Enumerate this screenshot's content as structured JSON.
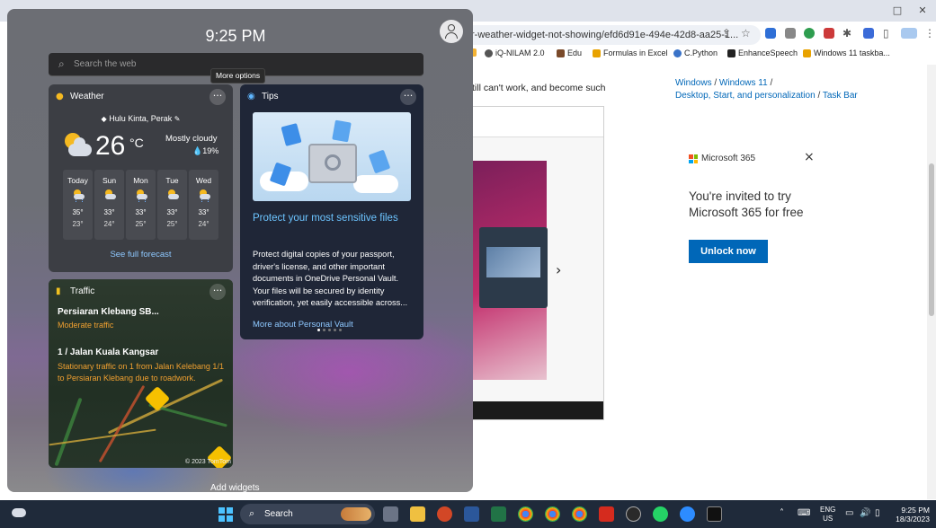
{
  "browser": {
    "url": "r-weather-widget-not-showing/efd6d91e-494e-42d8-aa25-1...",
    "bookmarks": [
      "iQ-NILAM 2.0",
      "Edu",
      "Formulas in Excel",
      "C.Python",
      "EnhanceSpeech",
      "Windows 11 taskba..."
    ],
    "page_text": "till can't work, and become such",
    "breadcrumbs": {
      "item1": "Windows",
      "item2": "Windows 11",
      "item3": "Desktop, Start, and personalization",
      "item4": "Task Bar",
      "sep": "/"
    },
    "ad": {
      "brand": "Microsoft 365",
      "headline": "You're invited to try Microsoft 365 for free",
      "cta": "Unlock now"
    }
  },
  "widgets": {
    "time": "9:25 PM",
    "search_placeholder": "Search the web",
    "tooltip": "More options",
    "weather": {
      "title": "Weather",
      "location": "Hulu Kinta, Perak",
      "temperature": "26",
      "unit": "°C",
      "condition": "Mostly cloudy",
      "precip": "19%",
      "forecast": [
        {
          "day": "Today",
          "hi": "35°",
          "lo": "23°",
          "icon": "rain-cloud-icon"
        },
        {
          "day": "Sun",
          "hi": "33°",
          "lo": "24°",
          "icon": "partly-cloudy-icon"
        },
        {
          "day": "Mon",
          "hi": "33°",
          "lo": "25°",
          "icon": "rain-cloud-icon"
        },
        {
          "day": "Tue",
          "hi": "33°",
          "lo": "25°",
          "icon": "partly-cloudy-icon"
        },
        {
          "day": "Wed",
          "hi": "33°",
          "lo": "24°",
          "icon": "rain-cloud-icon"
        }
      ],
      "link": "See full forecast"
    },
    "tips": {
      "title": "Tips",
      "headline": "Protect your most sensitive files",
      "body": "Protect digital copies of your passport, driver's license, and other important documents in OneDrive Personal Vault. Your files will be secured by identity verification, yet easily accessible across...",
      "link": "More about Personal Vault"
    },
    "traffic": {
      "title": "Traffic",
      "route1": "Persiaran Klebang SB...",
      "route1_status": "Moderate traffic",
      "route2": "1 / Jalan Kuala Kangsar",
      "route2_status": "Stationary traffic on 1 from Jalan Kelebang 1/1 to Persiaran Klebang due to roadwork.",
      "credit": "© 2023 TomTom"
    },
    "add_widgets": "Add widgets"
  },
  "taskbar": {
    "search_label": "Search",
    "lang_top": "ENG",
    "lang_bottom": "US",
    "time": "9:25 PM",
    "date": "18/3/2023"
  },
  "colors": {
    "accent": "#0067b8",
    "link_light": "#8ec8ff",
    "traffic_orange": "#f0a030"
  }
}
